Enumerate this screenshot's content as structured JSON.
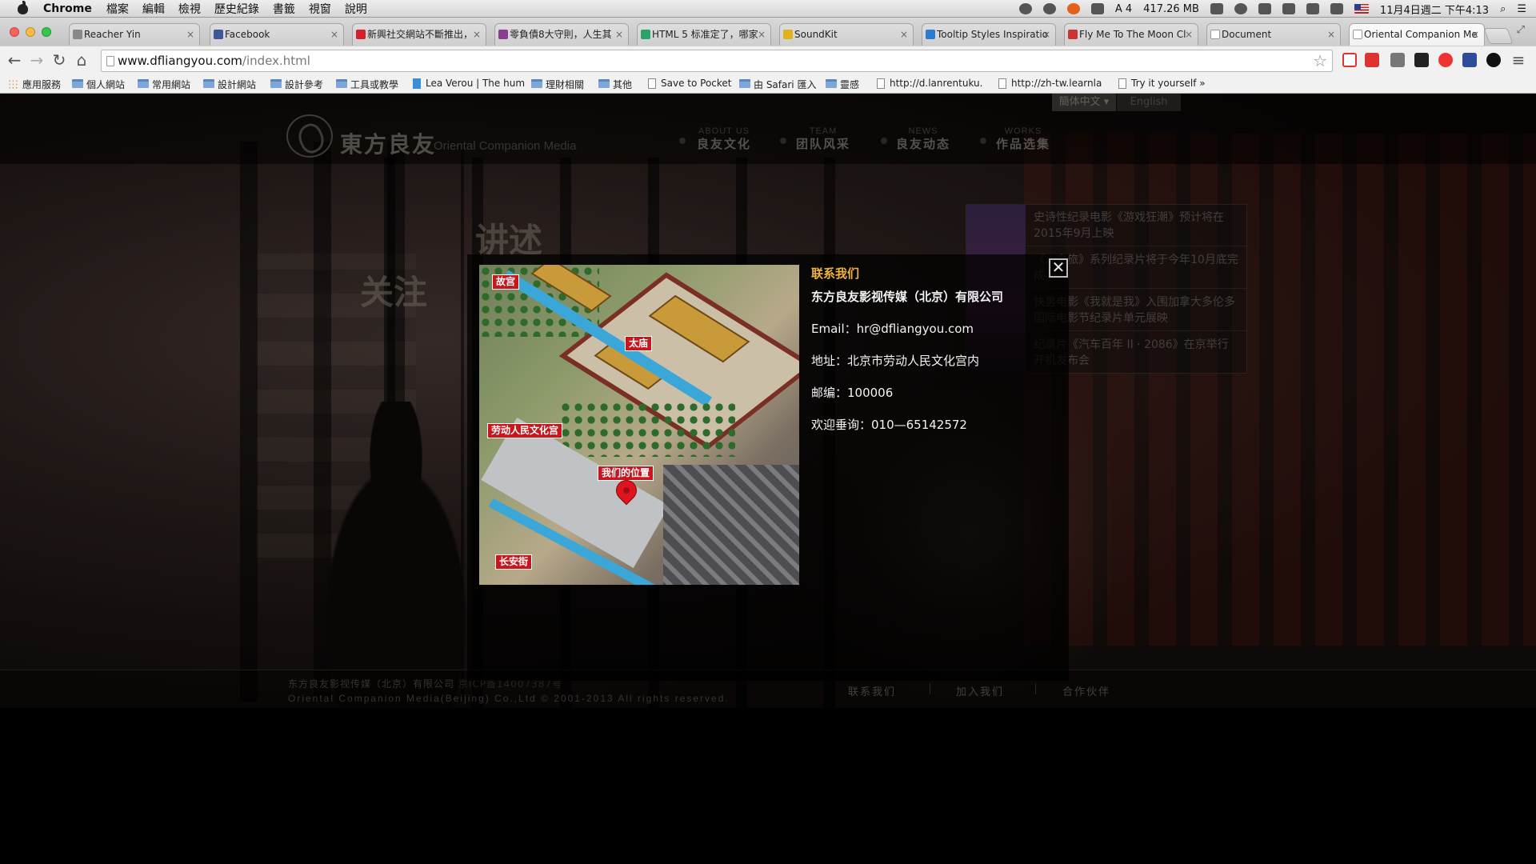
{
  "menubar": {
    "app": "Chrome",
    "items": [
      "檔案",
      "編輯",
      "檢視",
      "歷史紀錄",
      "書籤",
      "視窗",
      "說明"
    ],
    "status": {
      "badge": "4",
      "memory": "417.26 MB",
      "datetime": "11月4日週二 下午4:13"
    }
  },
  "tabs": [
    {
      "title": "Reacher Yin"
    },
    {
      "title": "Facebook"
    },
    {
      "title": "新興社交網站不斷推出，"
    },
    {
      "title": "零負債8大守則，人生其"
    },
    {
      "title": "HTML 5 标准定了，哪家"
    },
    {
      "title": "SoundKit"
    },
    {
      "title": "Tooltip Styles Inspiratio"
    },
    {
      "title": "Fly Me To The Moon Cl"
    },
    {
      "title": "Document"
    },
    {
      "title": "Oriental Companion Me"
    }
  ],
  "omnibox": {
    "host": "www.dfliangyou.com",
    "path": "/index.html"
  },
  "bookmarks": [
    {
      "label": "應用服務",
      "icon": "apps"
    },
    {
      "label": "個人網站",
      "icon": "folder"
    },
    {
      "label": "常用網站",
      "icon": "folder"
    },
    {
      "label": "設計網站",
      "icon": "folder"
    },
    {
      "label": "設計參考",
      "icon": "folder"
    },
    {
      "label": "工具或教學",
      "icon": "folder"
    },
    {
      "label": "Lea Verou | The hum",
      "icon": "v"
    },
    {
      "label": "理財相關",
      "icon": "folder"
    },
    {
      "label": "其他",
      "icon": "folder"
    },
    {
      "label": "Save to Pocket",
      "icon": "file"
    },
    {
      "label": "由 Safari 匯入",
      "icon": "folder"
    },
    {
      "label": "靈感",
      "icon": "folder"
    },
    {
      "label": "http://d.lanrentuku.",
      "icon": "file"
    },
    {
      "label": "http://zh-tw.learnla",
      "icon": "file"
    },
    {
      "label": "Try it yourself »",
      "icon": "file"
    }
  ],
  "site": {
    "logo_cn": "東方良友",
    "logo_en": "Oriental Companion Media",
    "lang": {
      "zh": "簡体中文",
      "en": "English"
    },
    "nav": [
      {
        "en": "ABOUT US",
        "zh": "良友文化"
      },
      {
        "en": "TEAM",
        "zh": "团队风采"
      },
      {
        "en": "NEWS",
        "zh": "良友动态"
      },
      {
        "en": "WORKS",
        "zh": "作品选集"
      }
    ],
    "slogan1": "讲述",
    "slogan2": "关注",
    "news": [
      "史诗性纪录电影《游戏狂潮》预计将在2015年9月上映",
      "《…之旅》系列纪录片将于今年10月底完成",
      "快男电影《我就是我》入围加拿大多伦多国际电影节纪录片单元展映",
      "纪录片《汽车百年 II · 2086》在京举行开机发布会"
    ],
    "footer": {
      "company": "东方良友影视传媒（北京）有限公司",
      "icp": "京ICP备14007387号",
      "copyright": "Oriental Companion Media(Beijing) Co.,Ltd © 2001-2013 All rights reserved.",
      "links": [
        "联系我们",
        "加入我们",
        "合作伙伴"
      ]
    }
  },
  "modal": {
    "title": "联系我们",
    "company": "东方良友影视传媒（北京）有限公司",
    "email": "Email：hr@dfliangyou.com",
    "address": "地址：北京市劳动人民文化宫内",
    "postcode": "邮编：100006",
    "phone": "欢迎垂询：010—65142572",
    "close": "✕",
    "map_labels": [
      "故宫",
      "太庙",
      "劳动人民文化宫",
      "我们的位置",
      "长安街"
    ]
  }
}
